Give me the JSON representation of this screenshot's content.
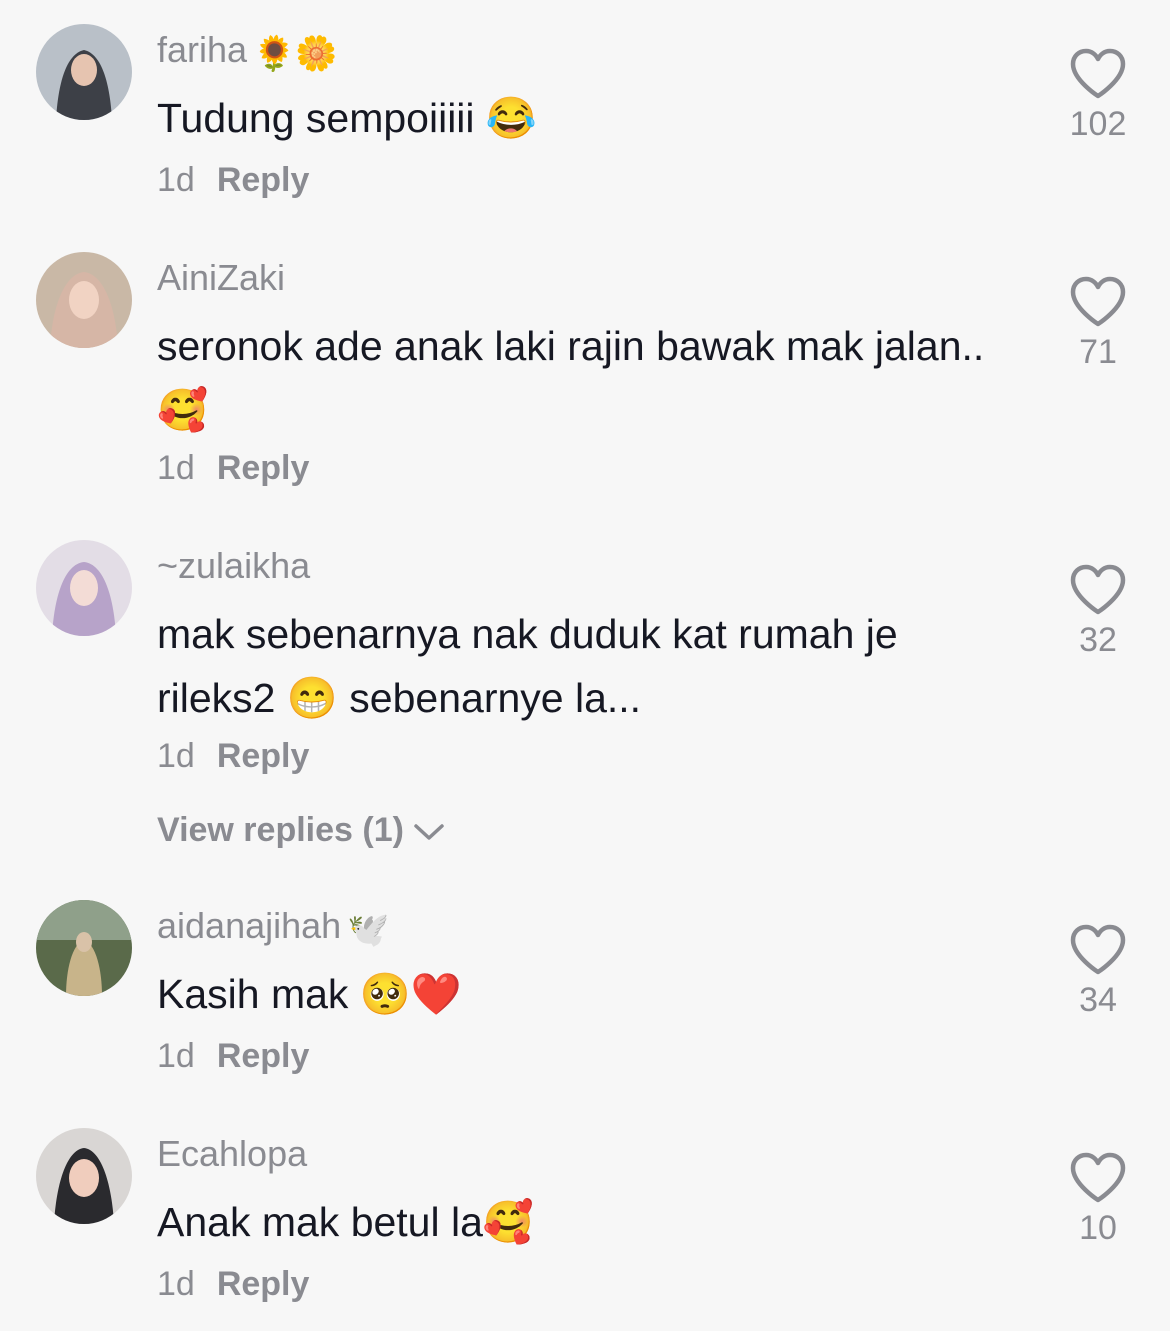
{
  "comments": [
    {
      "username": "fariha",
      "username_emoji": "🌻🌼",
      "text": "Tudung sempoiiiii 😂",
      "time": "1d",
      "reply_label": "Reply",
      "likes": "102",
      "avatar_colors": {
        "bg": "#b9c0c8",
        "face": "#e6c4b0",
        "cloth": "#3d4047"
      }
    },
    {
      "username": "AiniZaki",
      "username_emoji": "",
      "text": "seronok ade anak laki rajin bawak mak jalan..🥰",
      "time": "1d",
      "reply_label": "Reply",
      "likes": "71",
      "avatar_colors": {
        "bg": "#c9b8a6",
        "face": "#f1d3c3",
        "cloth": "#d6b6a6"
      }
    },
    {
      "username": "~zulaikha",
      "username_emoji": "",
      "text": "mak sebenarnya nak duduk kat rumah je rileks2 😁 sebenarnye la...",
      "time": "1d",
      "reply_label": "Reply",
      "likes": "32",
      "view_replies": "View replies (1)",
      "avatar_colors": {
        "bg": "#e3dde6",
        "face": "#f3dcd6",
        "cloth": "#b7a3c9"
      }
    },
    {
      "username": "aidanajihah",
      "username_emoji": "🕊️",
      "text": "Kasih mak 🥺❤️",
      "time": "1d",
      "reply_label": "Reply",
      "likes": "34",
      "avatar_colors": {
        "bg": "#5a6a4a",
        "face": "#d9c2a8",
        "cloth": "#c8b48a"
      }
    },
    {
      "username": "Ecahlopa",
      "username_emoji": "",
      "text": "Anak mak betul la🥰",
      "time": "1d",
      "reply_label": "Reply",
      "likes": "10",
      "avatar_colors": {
        "bg": "#d9d6d4",
        "face": "#f0cdbd",
        "cloth": "#2a2a2e"
      }
    }
  ],
  "icons": {
    "like": "heart-outline-icon",
    "expand": "chevron-down-icon"
  },
  "colors": {
    "text": "#161823",
    "secondary": "#8a8b91",
    "background": "#f7f7f7"
  }
}
